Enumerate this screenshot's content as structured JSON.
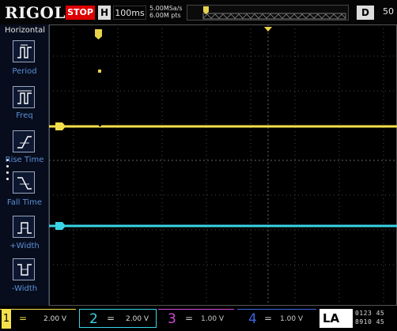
{
  "brand": "RIGOL",
  "status": "STOP",
  "horizontal": {
    "label": "H",
    "timebase": "100ms"
  },
  "acquisition": {
    "sample_rate": "5.00MSa/s",
    "memory_depth": "6.00M pts"
  },
  "trigger_box": {
    "label": "D",
    "value": "50"
  },
  "menu": {
    "title": "Horizontal",
    "items": [
      {
        "label": "Period",
        "icon": "period-icon"
      },
      {
        "label": "Freq",
        "icon": "freq-icon"
      },
      {
        "label": "Rise Time",
        "icon": "rise-time-icon"
      },
      {
        "label": "Fall Time",
        "icon": "fall-time-icon"
      },
      {
        "label": "+Width",
        "icon": "positive-width-icon"
      },
      {
        "label": "-Width",
        "icon": "negative-width-icon"
      }
    ]
  },
  "markers": {
    "trigger_position": "T",
    "ch1": "1",
    "ch2": "2"
  },
  "channels": [
    {
      "number": "1",
      "coupling": "=",
      "scale": "2.00 V",
      "color": "#f4e04a",
      "active": true
    },
    {
      "number": "2",
      "coupling": "=",
      "scale": "2.00 V",
      "color": "#39d4e6",
      "active": false
    },
    {
      "number": "3",
      "coupling": "=",
      "scale": "1.00 V",
      "color": "#d24bd6",
      "active": false
    },
    {
      "number": "4",
      "coupling": "=",
      "scale": "1.00 V",
      "color": "#3a67e0",
      "active": false
    }
  ],
  "logic_analyzer": {
    "label": "LA",
    "row1": "0123 45",
    "row2": "8910 45"
  },
  "colors": {
    "ch1": "#f4e04a",
    "ch2": "#39d4e6",
    "stop": "#dd0000",
    "grid": "#3a3a3a"
  }
}
